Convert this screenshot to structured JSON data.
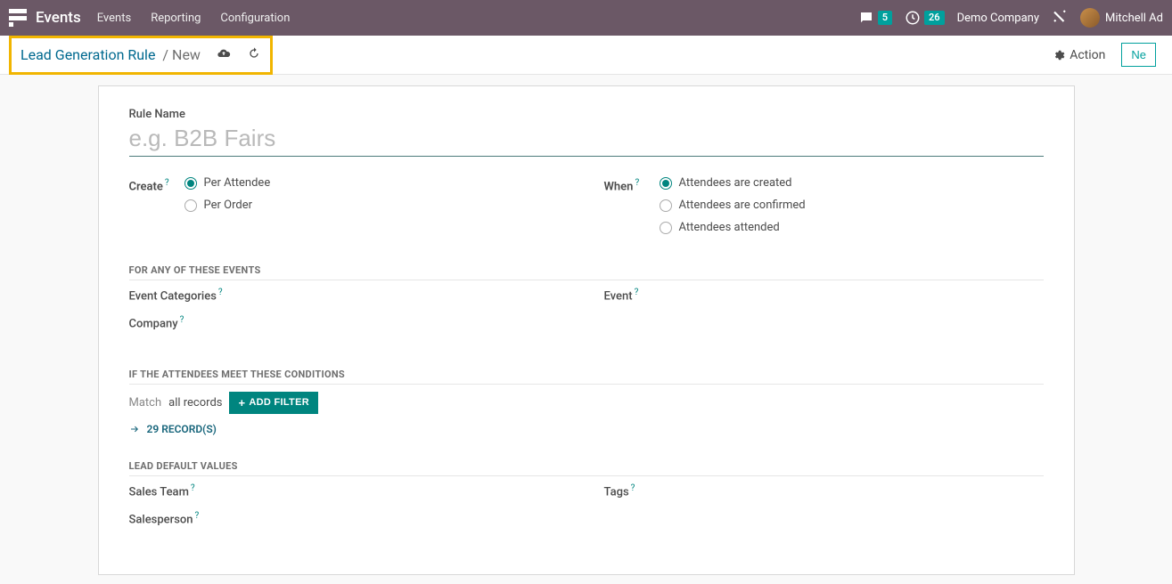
{
  "topbar": {
    "brand": "Events",
    "nav": [
      "Events",
      "Reporting",
      "Configuration"
    ],
    "chat_badge": "5",
    "clock_badge": "26",
    "company": "Demo Company",
    "user": "Mitchell Ad"
  },
  "actionbar": {
    "breadcrumb_parent": "Lead Generation Rule",
    "breadcrumb_current": "New",
    "action_label": "Action",
    "new_label": "Ne"
  },
  "form": {
    "rule_name_label": "Rule Name",
    "rule_name_placeholder": "e.g. B2B Fairs",
    "create_label": "Create",
    "create_options": {
      "per_attendee": "Per Attendee",
      "per_order": "Per Order"
    },
    "when_label": "When",
    "when_options": {
      "created": "Attendees are created",
      "confirmed": "Attendees are confirmed",
      "attended": "Attendees attended"
    },
    "section_events": "For any of these Events",
    "event_categories_label": "Event Categories",
    "company_label": "Company",
    "event_label": "Event",
    "section_conditions": "If the Attendees meet these Conditions",
    "match_prefix": "Match",
    "match_scope": "all records",
    "add_filter_label": "ADD FILTER",
    "records_label": "29 RECORD(S)",
    "section_lead_defaults": "Lead Default Values",
    "sales_team_label": "Sales Team",
    "salesperson_label": "Salesperson",
    "tags_label": "Tags",
    "help": "?"
  }
}
